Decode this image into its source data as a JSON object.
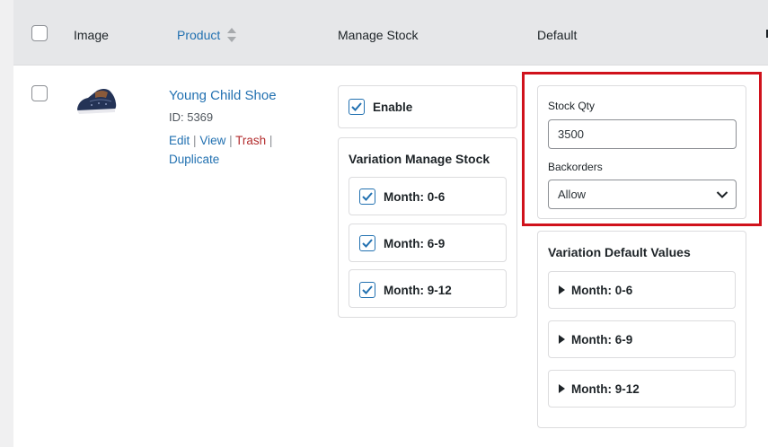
{
  "header": {
    "image_label": "Image",
    "product_label": "Product",
    "manage_stock_label": "Manage Stock",
    "default_label": "Default"
  },
  "product": {
    "name": "Young Child Shoe",
    "id_text": "ID: 5369",
    "actions": {
      "edit": "Edit",
      "view": "View",
      "trash": "Trash",
      "duplicate": "Duplicate",
      "separator": "|"
    }
  },
  "manage_stock": {
    "enable_label": "Enable",
    "enable_checked": true,
    "variation_title": "Variation Manage Stock",
    "variations": [
      {
        "label": "Month: 0-6",
        "checked": true
      },
      {
        "label": "Month: 6-9",
        "checked": true
      },
      {
        "label": "Month: 9-12",
        "checked": true
      }
    ]
  },
  "default": {
    "stock_qty_label": "Stock Qty",
    "stock_qty_value": "3500",
    "backorders_label": "Backorders",
    "backorders_value": "Allow",
    "variation_defaults_title": "Variation Default Values",
    "variation_defaults": [
      "Month: 0-6",
      "Month: 6-9",
      "Month: 9-12"
    ]
  },
  "colors": {
    "link": "#2271b1",
    "trash": "#b32d2e",
    "highlight": "#d0121c",
    "header_bg": "#e6e7e9"
  },
  "icons": {
    "sort": "sort-arrows-icon",
    "chevron": "chevron-down-icon",
    "expand": "triangle-right-icon",
    "check": "checkmark-icon"
  }
}
